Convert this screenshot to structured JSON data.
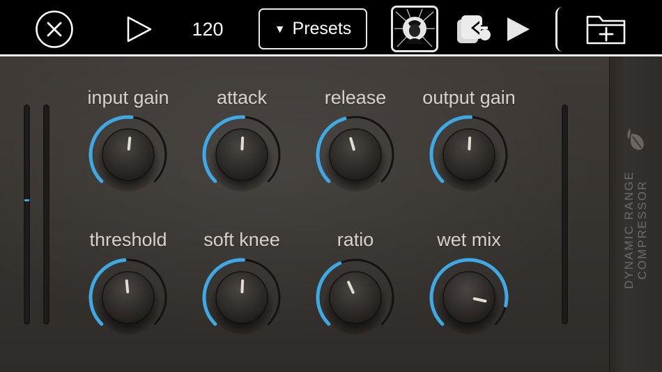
{
  "toolbar": {
    "close_icon": "close-circle-icon",
    "play_icon": "play-outline-icon",
    "tempo": "120",
    "presets_label": "Presets",
    "presets_caret_icon": "triangle-down-icon",
    "plugin_thumbnail": "plugin-thumbnail-icon",
    "route_icon": "audio-routing-icon",
    "route_play_icon": "play-filled-icon",
    "folder_icon": "folder-add-icon"
  },
  "plugin": {
    "brand_line1": "DYNAMIC RANGE",
    "brand_line2": "COMPRESSOR",
    "accent_color": "#3fa9e6",
    "meters": {
      "input_left_level": 0.57,
      "input_right_level": 0,
      "output_level": 0
    },
    "knobs": [
      {
        "id": "input-gain",
        "label": "input gain",
        "value": 0.52
      },
      {
        "id": "attack",
        "label": "attack",
        "value": 0.51
      },
      {
        "id": "release",
        "label": "release",
        "value": 0.44
      },
      {
        "id": "output-gain",
        "label": "output gain",
        "value": 0.51
      },
      {
        "id": "threshold",
        "label": "threshold",
        "value": 0.48
      },
      {
        "id": "soft-knee",
        "label": "soft knee",
        "value": 0.51
      },
      {
        "id": "ratio",
        "label": "ratio",
        "value": 0.41
      },
      {
        "id": "wet-mix",
        "label": "wet mix",
        "value": 0.88
      }
    ]
  }
}
